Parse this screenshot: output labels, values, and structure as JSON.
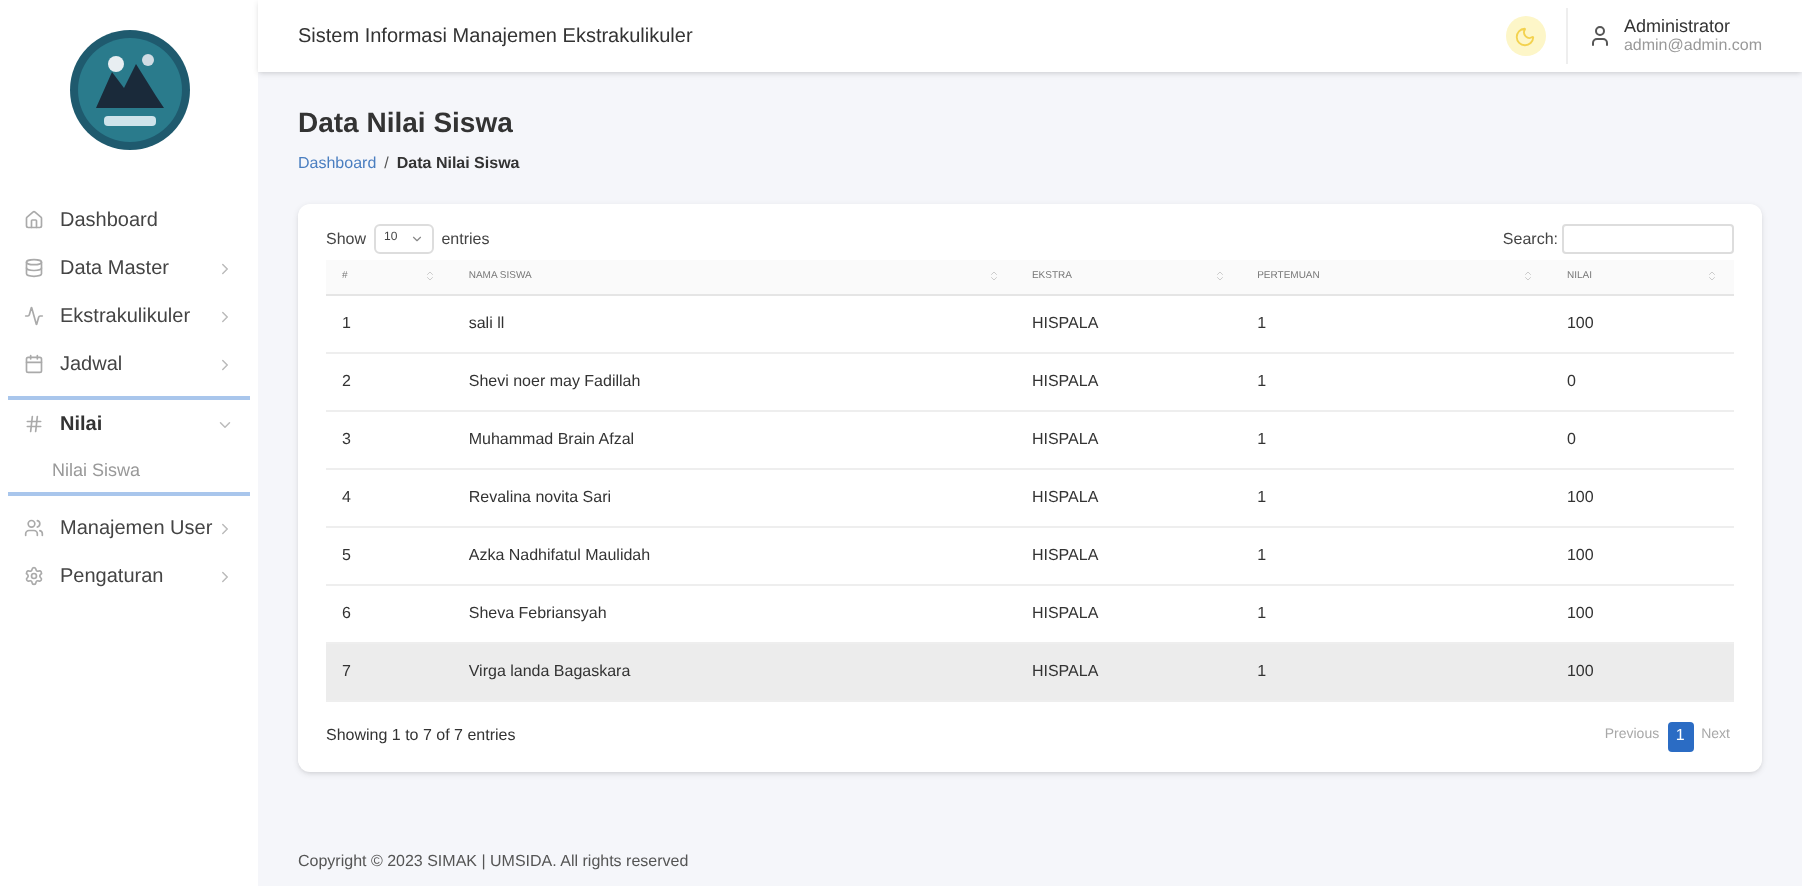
{
  "header": {
    "title": "Sistem Informasi Manajemen Ekstrakulikuler",
    "user": {
      "name": "Administrator",
      "email": "admin@admin.com"
    }
  },
  "sidebar": {
    "items": [
      {
        "label": "Dashboard",
        "kind": "link",
        "active": false
      },
      {
        "label": "Data Master",
        "kind": "dropdown",
        "active": false,
        "expanded": false
      },
      {
        "label": "Ekstrakulikuler",
        "kind": "dropdown",
        "active": false,
        "expanded": false
      },
      {
        "label": "Jadwal",
        "kind": "dropdown",
        "active": false,
        "expanded": false
      },
      {
        "label": "Nilai",
        "kind": "dropdown",
        "active": true,
        "expanded": true,
        "children": [
          {
            "label": "Nilai Siswa"
          }
        ]
      },
      {
        "label": "Manajemen User",
        "kind": "dropdown",
        "active": false,
        "expanded": false
      },
      {
        "label": "Pengaturan",
        "kind": "dropdown",
        "active": false,
        "expanded": false
      }
    ]
  },
  "page": {
    "title": "Data Nilai Siswa",
    "breadcrumb": [
      {
        "label": "Dashboard",
        "selected": false
      },
      {
        "label": "Data Nilai Siswa",
        "selected": true
      }
    ],
    "separator": "/"
  },
  "table_controls": {
    "show_label": "Show",
    "page_size": "10",
    "entries_label": "entries",
    "search_label": "Search:"
  },
  "table": {
    "columns": [
      "#",
      "NAMA SISWA",
      "EKSTRA",
      "PERTEMUAN",
      "NILAI"
    ],
    "rows": [
      {
        "cells": [
          "1",
          "sali ll",
          "HISPALA",
          "1",
          "100"
        ],
        "highlighted": false
      },
      {
        "cells": [
          "2",
          "Shevi noer may Fadillah",
          "HISPALA",
          "1",
          "0"
        ],
        "highlighted": false
      },
      {
        "cells": [
          "3",
          "Muhammad Brain Afzal",
          "HISPALA",
          "1",
          "0"
        ],
        "highlighted": false
      },
      {
        "cells": [
          "4",
          "Revalina novita Sari",
          "HISPALA",
          "1",
          "100"
        ],
        "highlighted": false
      },
      {
        "cells": [
          "5",
          "Azka Nadhifatul Maulidah",
          "HISPALA",
          "1",
          "100"
        ],
        "highlighted": false
      },
      {
        "cells": [
          "6",
          "Sheva Febriansyah",
          "HISPALA",
          "1",
          "100"
        ],
        "highlighted": false
      },
      {
        "cells": [
          "7",
          "Virga landa Bagaskara",
          "HISPALA",
          "1",
          "100"
        ],
        "highlighted": true
      }
    ]
  },
  "table_info": "Showing 1 to 7 of 7 entries",
  "pagination": [
    {
      "label": "Previous",
      "kind": "nav",
      "disabled": true
    },
    {
      "label": "1",
      "kind": "page",
      "selected": true
    },
    {
      "label": "Next",
      "kind": "nav",
      "disabled": true
    }
  ],
  "footer": "Copyright © 2023 SIMAK | UMSIDA. All rights reserved"
}
